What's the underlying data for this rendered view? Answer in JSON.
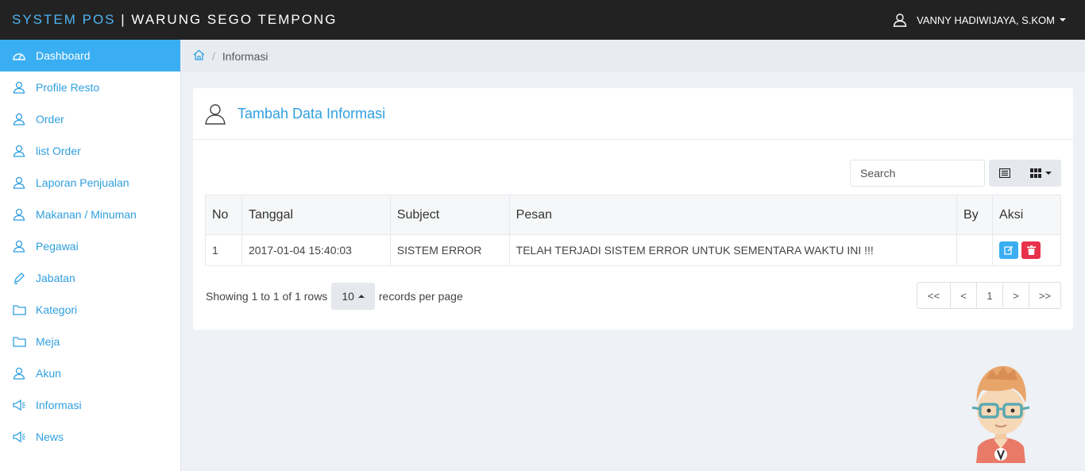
{
  "app": {
    "brand_prefix": "SYSTEM POS",
    "brand_sep": " | ",
    "brand_name": "WARUNG SEGO TEMPONG",
    "user_name": "VANNY HADIWIJAYA, S.KOM"
  },
  "sidebar": {
    "items": [
      {
        "label": "Dashboard",
        "icon": "dashboard-icon",
        "active": true
      },
      {
        "label": "Profile Resto",
        "icon": "user-icon"
      },
      {
        "label": "Order",
        "icon": "user-icon"
      },
      {
        "label": "list Order",
        "icon": "user-icon"
      },
      {
        "label": "Laporan Penjualan",
        "icon": "user-icon"
      },
      {
        "label": "Makanan / Minuman",
        "icon": "user-icon"
      },
      {
        "label": "Pegawai",
        "icon": "user-icon"
      },
      {
        "label": "Jabatan",
        "icon": "pen-icon"
      },
      {
        "label": "Kategori",
        "icon": "folder-icon"
      },
      {
        "label": "Meja",
        "icon": "folder-icon"
      },
      {
        "label": "Akun",
        "icon": "user-icon"
      },
      {
        "label": "Informasi",
        "icon": "megaphone-icon"
      },
      {
        "label": "News",
        "icon": "megaphone-icon"
      }
    ]
  },
  "breadcrumb": {
    "current": "Informasi"
  },
  "panel": {
    "title": "Tambah Data Informasi"
  },
  "search": {
    "placeholder": "Search"
  },
  "table": {
    "headers": [
      "No",
      "Tanggal",
      "Subject",
      "Pesan",
      "By",
      "Aksi"
    ],
    "rows": [
      {
        "no": "1",
        "tanggal": "2017-01-04 15:40:03",
        "subject": "SISTEM ERROR",
        "pesan": "TELAH TERJADI SISTEM ERROR UNTUK SEMENTARA WAKTU INI !!!",
        "by": ""
      }
    ]
  },
  "footer": {
    "showing": "Showing 1 to 1 of 1 rows",
    "per_page": "10",
    "records": "records per page"
  },
  "pager": {
    "first": "<<",
    "prev": "<",
    "page": "1",
    "next": ">",
    "last": ">>"
  },
  "colors": {
    "accent": "#3aaef2",
    "danger": "#e8314a",
    "topbar": "#222222"
  }
}
